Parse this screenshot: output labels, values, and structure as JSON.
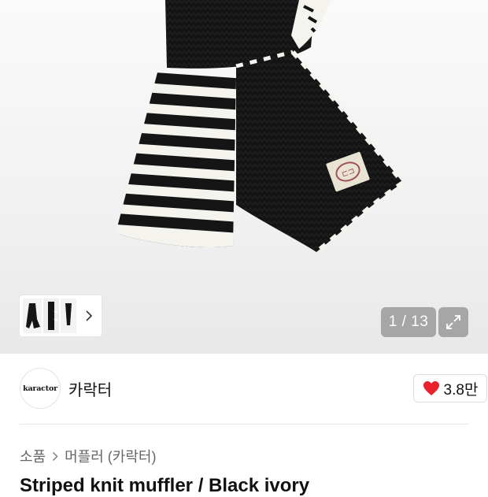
{
  "gallery": {
    "counter": "1 / 13",
    "thumbnail_icon": "chevron-right-icon",
    "expand_icon": "expand-icon"
  },
  "brand": {
    "logo_text": "karactor",
    "name": "카락터"
  },
  "likes": {
    "icon": "heart-icon",
    "count": "3.8만",
    "heart_color": "#e8232b"
  },
  "breadcrumb": {
    "items": [
      "소품",
      "머플러 (카락터)"
    ]
  },
  "product": {
    "title": "Striped knit muffler / Black ivory"
  }
}
